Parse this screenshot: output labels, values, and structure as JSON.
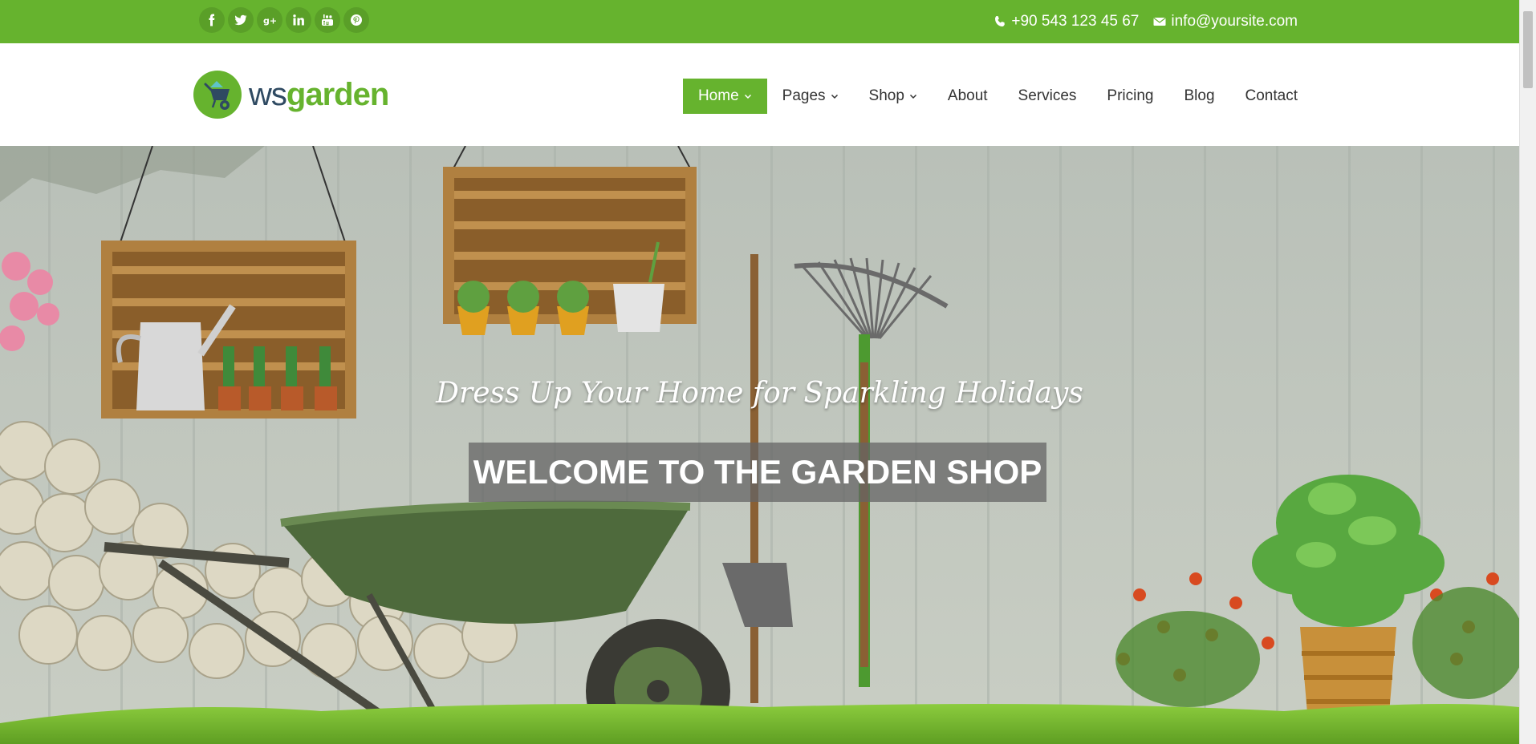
{
  "topbar": {
    "socials": [
      {
        "icon": "facebook-icon",
        "glyph": "f"
      },
      {
        "icon": "twitter-icon",
        "glyph": "t"
      },
      {
        "icon": "google-plus-icon",
        "glyph": "g+"
      },
      {
        "icon": "linkedin-icon",
        "glyph": "in"
      },
      {
        "icon": "youtube-icon",
        "glyph": "yt"
      },
      {
        "icon": "pinterest-icon",
        "glyph": "p"
      }
    ],
    "phone": "+90 543 123 45 67",
    "email": "info@yoursite.com"
  },
  "header": {
    "logo_ws": "ws",
    "logo_garden": "garden",
    "nav": [
      {
        "label": "Home",
        "dropdown": true,
        "active": true
      },
      {
        "label": "Pages",
        "dropdown": true,
        "active": false
      },
      {
        "label": "Shop",
        "dropdown": true,
        "active": false
      },
      {
        "label": "About",
        "dropdown": false,
        "active": false
      },
      {
        "label": "Services",
        "dropdown": false,
        "active": false
      },
      {
        "label": "Pricing",
        "dropdown": false,
        "active": false
      },
      {
        "label": "Blog",
        "dropdown": false,
        "active": false
      },
      {
        "label": "Contact",
        "dropdown": false,
        "active": false
      }
    ]
  },
  "hero": {
    "tagline": "Dress Up Your Home for Sparkling Holidays",
    "title": "WELCOME TO THE GARDEN SHOP"
  },
  "colors": {
    "brand_green": "#66b32e",
    "logo_navy": "#2f4a62"
  }
}
